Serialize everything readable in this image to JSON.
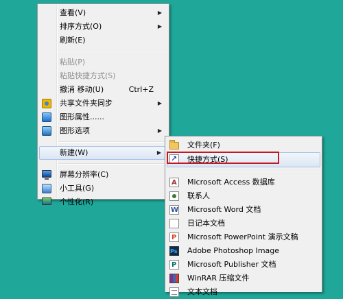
{
  "context_menu": {
    "items": [
      {
        "label": "查看(V)",
        "submenu": true
      },
      {
        "label": "排序方式(O)",
        "submenu": true
      },
      {
        "label": "刷新(E)"
      },
      {
        "label": "粘贴(P)",
        "disabled": true
      },
      {
        "label": "粘贴快捷方式(S)",
        "disabled": true
      },
      {
        "label": "撤消 移动(U)",
        "shortcut": "Ctrl+Z"
      },
      {
        "label": "共享文件夹同步",
        "submenu": true,
        "icon": "shared-folder-sync-icon"
      },
      {
        "label": "图形属性......",
        "icon": "graphics-properties-icon"
      },
      {
        "label": "图形选项",
        "submenu": true,
        "icon": "graphics-options-icon"
      },
      {
        "label": "新建(W)",
        "submenu": true,
        "hover": true
      },
      {
        "label": "屏幕分辨率(C)",
        "icon": "screen-resolution-icon"
      },
      {
        "label": "小工具(G)",
        "icon": "gadgets-icon"
      },
      {
        "label": "个性化(R)",
        "icon": "personalize-icon"
      }
    ],
    "arrow": "▶"
  },
  "submenu": {
    "items": [
      {
        "label": "文件夹(F)",
        "icon": "folder-icon"
      },
      {
        "label": "快捷方式(S)",
        "icon": "shortcut-icon",
        "hover": true
      },
      {
        "label": "Microsoft Access 数据库",
        "icon": "access-icon"
      },
      {
        "label": "联系人",
        "icon": "contact-icon"
      },
      {
        "label": "Microsoft Word 文档",
        "icon": "word-icon"
      },
      {
        "label": "日记本文档",
        "icon": "journal-icon"
      },
      {
        "label": "Microsoft PowerPoint 演示文稿",
        "icon": "powerpoint-icon"
      },
      {
        "label": "Adobe Photoshop Image",
        "icon": "photoshop-icon"
      },
      {
        "label": "Microsoft Publisher 文档",
        "icon": "publisher-icon"
      },
      {
        "label": "WinRAR 压缩文件",
        "icon": "winrar-icon"
      },
      {
        "label": "文本文档",
        "icon": "text-document-icon"
      }
    ]
  },
  "colors": {
    "desktop": "#1fa79a",
    "highlight_border": "#c8171e",
    "menu_background": "#f0f0f0"
  }
}
